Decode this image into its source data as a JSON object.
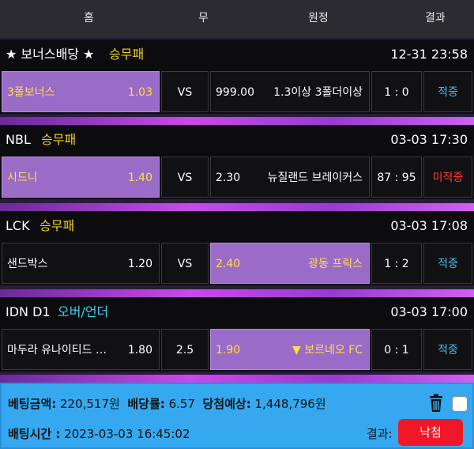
{
  "header": {
    "home": "홈",
    "draw": "무",
    "away": "원정",
    "result": "결과"
  },
  "bets": [
    {
      "league": "★ 보너스배당 ★",
      "market": "승무패",
      "time": "12-31 23:58",
      "home_team": "3폴보너스",
      "home_odds": "1.03",
      "draw": "VS",
      "away_odds": "999.00",
      "away_team": "1.3이상 3폴더이상",
      "score": "1 : 0",
      "result": "적중"
    },
    {
      "league": "NBL",
      "market": "승무패",
      "time": "03-03 17:30",
      "home_team": "시드니",
      "home_odds": "1.40",
      "draw": "VS",
      "away_odds": "2.30",
      "away_team": "뉴질랜드 브레이커스",
      "score": "87 : 95",
      "result": "미적중"
    },
    {
      "league": "LCK",
      "market": "승무패",
      "time": "03-03 17:08",
      "home_team": "샌드박스",
      "home_odds": "1.20",
      "draw": "VS",
      "away_odds": "2.40",
      "away_team": "광동 프릭스",
      "score": "1 : 2",
      "result": "적중"
    },
    {
      "league": "IDN D1",
      "market": "오버/언더",
      "time": "03-03 17:00",
      "home_team": "마두라 유나이티드 …",
      "home_odds": "1.80",
      "draw": "2.5",
      "away_odds": "1.90",
      "away_team": "▼ 보르네오 FC",
      "score": "0 : 1",
      "result": "적중"
    }
  ],
  "footer": {
    "bet_amount_label": "베팅금액:",
    "bet_amount": "220,517원",
    "odds_label": "배당률:",
    "odds": "6.57",
    "expected_label": "당첨예상:",
    "expected": "1,448,796원",
    "bet_time_label": "배팅시간 :",
    "bet_time": "2023-03-03 16:45:02",
    "result_label": "결과:",
    "result_button": "낙첨"
  },
  "colors": {
    "selected": "#9b6bc8",
    "hit": "#4ab8f0",
    "miss": "#ff3a3a",
    "market": "#f0d020",
    "footer": "#35a8f0"
  }
}
